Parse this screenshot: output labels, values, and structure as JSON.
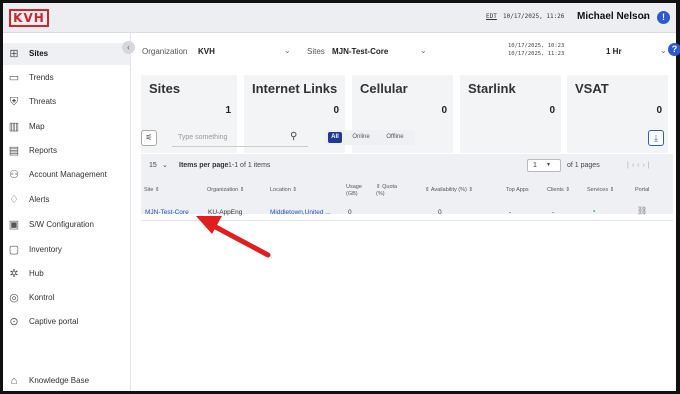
{
  "brand": {
    "logo_text": "KVH",
    "accent": "#d3232c"
  },
  "topbar": {
    "timezone": "EDT",
    "clock": "10/17/2025, 11:26",
    "user_name": "Michael Nelson"
  },
  "sidebar": {
    "items": [
      {
        "label": "Sites",
        "icon": "grid-icon",
        "glyph": "⊞",
        "active": true
      },
      {
        "label": "Trends",
        "icon": "monitor-icon",
        "glyph": "▭"
      },
      {
        "label": "Threats",
        "icon": "shield-icon",
        "glyph": "⛨"
      },
      {
        "label": "Map",
        "icon": "map-icon",
        "glyph": "▥"
      },
      {
        "label": "Reports",
        "icon": "report-icon",
        "glyph": "▤"
      },
      {
        "label": "Account Management",
        "icon": "users-icon",
        "glyph": "⚇"
      },
      {
        "label": "Alerts",
        "icon": "bell-icon",
        "glyph": "♢"
      },
      {
        "label": "S/W Configuration",
        "icon": "config-icon",
        "glyph": "▣"
      },
      {
        "label": "Inventory",
        "icon": "inventory-icon",
        "glyph": "▢"
      },
      {
        "label": "Hub",
        "icon": "hub-icon",
        "glyph": "✲"
      },
      {
        "label": "Kontrol",
        "icon": "kontrol-icon",
        "glyph": "◎"
      },
      {
        "label": "Captive portal",
        "icon": "portal-shield-icon",
        "glyph": "⊙"
      },
      {
        "label": "Knowledge Base",
        "icon": "knowledge-icon",
        "glyph": "⌂"
      }
    ]
  },
  "filters": {
    "organization_label": "Organization",
    "organization_value": "KVH",
    "sites_label": "Sites",
    "sites_value": "MJN-Test-Core",
    "range_start": "10/17/2025, 10:23",
    "range_end": "10/17/2025, 11:23",
    "period": "1 Hr"
  },
  "summary": [
    {
      "title": "Sites",
      "value": "1"
    },
    {
      "title": "Internet Links",
      "value": "0"
    },
    {
      "title": "Cellular",
      "value": "0"
    },
    {
      "title": "Starlink",
      "value": "0"
    },
    {
      "title": "VSAT",
      "value": "0"
    }
  ],
  "toolbar": {
    "search_placeholder": "Type something",
    "chips": [
      "All",
      "Online",
      "Offline"
    ]
  },
  "pager": {
    "page_size": "15",
    "items_per_page_label": "Items per page",
    "range_text": "1-1 of 1 items",
    "current_page": "1",
    "of_pages": "of 1 pages"
  },
  "table": {
    "headers": {
      "site": "Site ⇕",
      "organization": "Organization ⇕",
      "location": "Location ⇕",
      "usage": "Usage\n(GB)",
      "quota": "⇕ Quota\n(%)",
      "availability": "⇕ Availability (%) ⇕",
      "top_apps": "Top Apps",
      "clients": "Clients ⇕",
      "services": "Services ⇕",
      "portal": "Portal"
    },
    "rows": [
      {
        "site": "MJN-Test-Core",
        "organization": "KU-AppEng",
        "location": "Middletown,United ...",
        "usage": "0",
        "quota": "",
        "availability": "0",
        "top_apps": "-",
        "clients": "-"
      }
    ]
  },
  "colors": {
    "primary": "#1f3a93",
    "link": "#1f4fc9",
    "help": "#2b59d6",
    "arrow": "#e01e1e",
    "service_ok": "#2aa84a"
  }
}
